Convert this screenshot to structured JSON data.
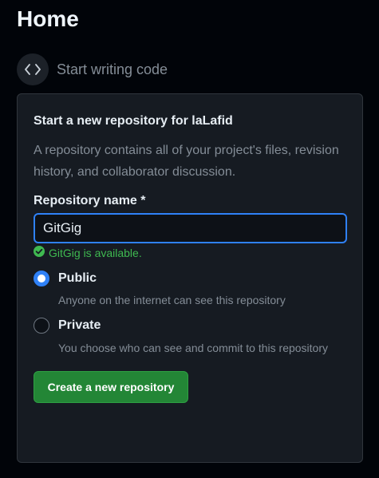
{
  "header": {
    "title": "Home"
  },
  "start_writing": {
    "icon": "code-icon",
    "label": "Start writing code"
  },
  "new_repo_card": {
    "title": "Start a new repository for laLafid",
    "description": "A repository contains all of your project's files, revision history, and collaborator discussion.",
    "name_label": "Repository name *",
    "name_value": "GitGig",
    "availability_icon": "check-circle-icon",
    "availability_text": "GitGig is available.",
    "visibility_options": [
      {
        "label": "Public",
        "description": "Anyone on the internet can see this repository",
        "selected": true
      },
      {
        "label": "Private",
        "description": "You choose who can see and commit to this repository",
        "selected": false
      }
    ],
    "create_button_label": "Create a new repository"
  },
  "colors": {
    "background": "#010409",
    "card": "#161b22",
    "accent": "#2f81f7",
    "success": "#3fb950",
    "button": "#238636"
  }
}
